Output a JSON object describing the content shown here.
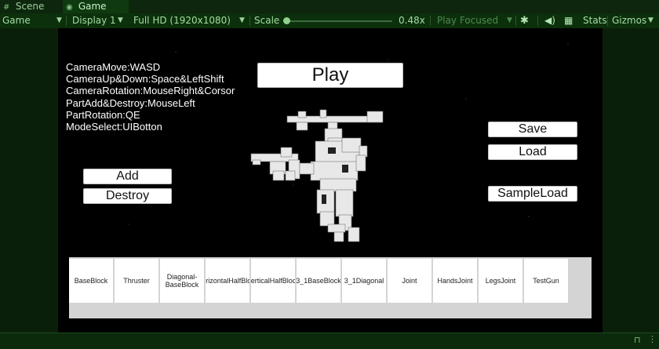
{
  "tabs": [
    {
      "label": "Scene",
      "icon": "hash-icon"
    },
    {
      "label": "Game",
      "icon": "gamepad-icon"
    }
  ],
  "toolbar": {
    "mode": "Game",
    "display": "Display 1",
    "resolution": "Full HD (1920x1080)",
    "scale_label": "Scale",
    "scale_value": "0.48x",
    "play_focused": "Play Focused",
    "stats": "Stats",
    "gizmos": "Gizmos"
  },
  "instructions": [
    "CameraMove:WASD",
    "CameraUp&Down:Space&LeftShift",
    "CameraRotation:MouseRight&Corsor",
    "PartAdd&Destroy:MouseLeft",
    "PartRotation:QE",
    "ModeSelect:UIBotton"
  ],
  "buttons": {
    "play": "Play",
    "save": "Save",
    "load": "Load",
    "sample_load": "SampleLoad",
    "add": "Add",
    "destroy": "Destroy"
  },
  "parts": [
    "BaseBlock",
    "Thruster",
    "Diagonal-BaseBlock",
    "HorizontalHalfBlock",
    "VerticalHalfBlock",
    "3_1BaseBlock",
    "3_1Diagonal",
    "Joint",
    "HandsJoint",
    "LegsJoint",
    "TestGun"
  ],
  "colors": {
    "editor_bg": "#0a1f0a",
    "viewport_bg": "#000000",
    "accent": "#8fd28f"
  }
}
